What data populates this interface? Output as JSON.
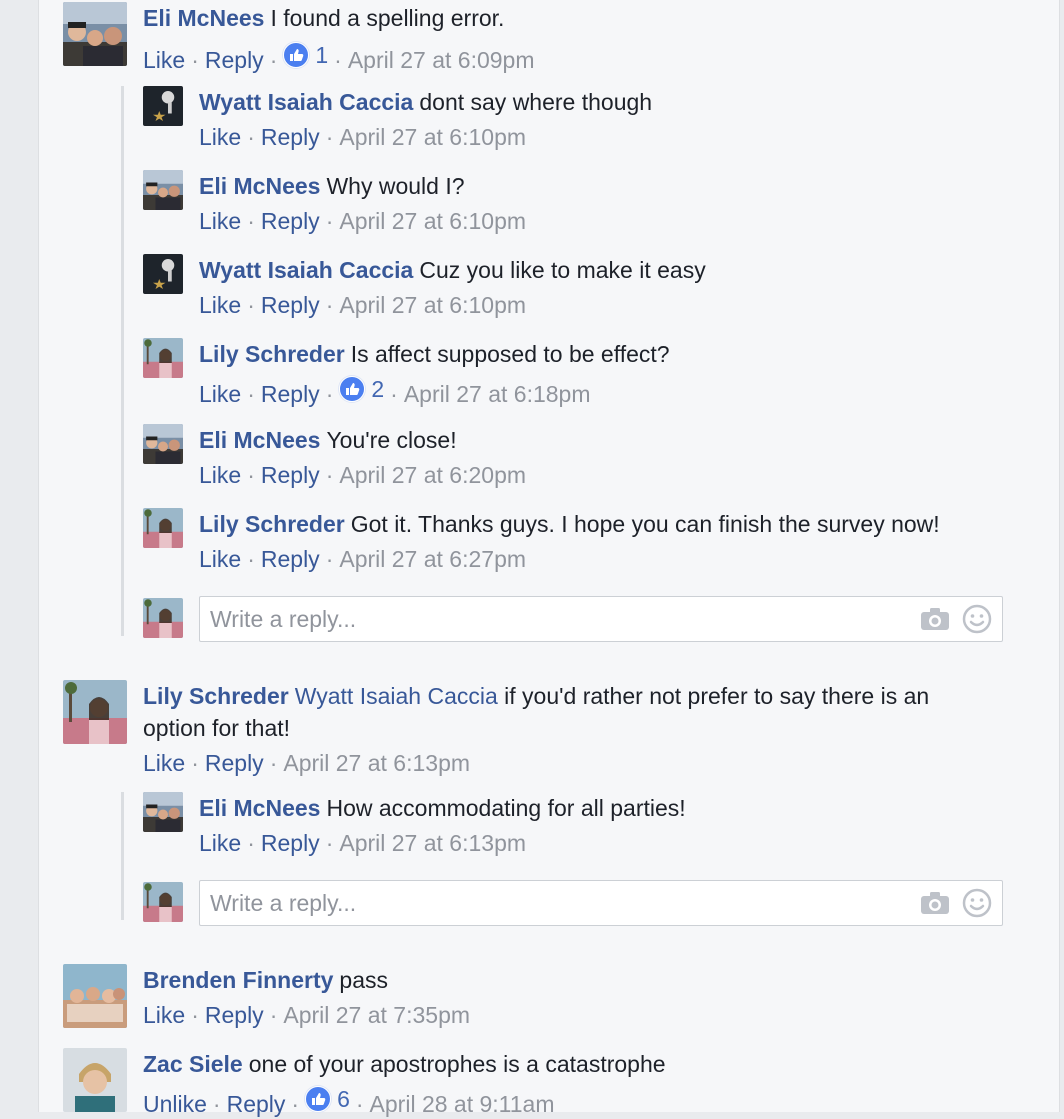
{
  "actions": {
    "like": "Like",
    "unlike": "Unlike",
    "reply": "Reply",
    "dot": "·"
  },
  "reply_box": {
    "placeholder": "Write a reply..."
  },
  "colors": {
    "link": "#385898",
    "meta": "#90949c",
    "like_blue": "#4b7ff0"
  },
  "icons": {
    "camera": "camera-icon",
    "emoji": "emoji-icon",
    "like": "like-thumb-icon"
  },
  "comments": [
    {
      "author": "Eli McNees",
      "text": "I found a spelling error.",
      "reactions": "1",
      "time": "April 27 at 6:09pm"
    },
    {
      "author": "Lily Schreder",
      "mention": "Wyatt Isaiah Caccia",
      "text": "if you'd rather not prefer to say there is an option for that!",
      "time": "April 27 at 6:13pm"
    },
    {
      "author": "Brenden Finnerty",
      "text": "pass",
      "time": "April 27 at 7:35pm"
    },
    {
      "author": "Zac Siele",
      "text": "one of your apostrophes is a catastrophe",
      "reactions": "6",
      "time": "April 28 at 9:11am"
    }
  ],
  "replies_a": [
    {
      "author": "Wyatt Isaiah Caccia",
      "text": "dont say where though",
      "time": "April 27 at 6:10pm"
    },
    {
      "author": "Eli McNees",
      "text": "Why would I?",
      "time": "April 27 at 6:10pm"
    },
    {
      "author": "Wyatt Isaiah Caccia",
      "text": "Cuz you like to make it easy",
      "time": "April 27 at 6:10pm"
    },
    {
      "author": "Lily Schreder",
      "text": "Is affect supposed to be effect?",
      "reactions": "2",
      "time": "April 27 at 6:18pm"
    },
    {
      "author": "Eli McNees",
      "text": "You're close!",
      "time": "April 27 at 6:20pm"
    },
    {
      "author": "Lily Schreder",
      "text": "Got it. Thanks guys. I hope you can finish the survey now!",
      "time": "April 27 at 6:27pm"
    }
  ],
  "replies_b": [
    {
      "author": "Eli McNees",
      "text": "How accommodating for all parties!",
      "time": "April 27 at 6:13pm"
    }
  ]
}
